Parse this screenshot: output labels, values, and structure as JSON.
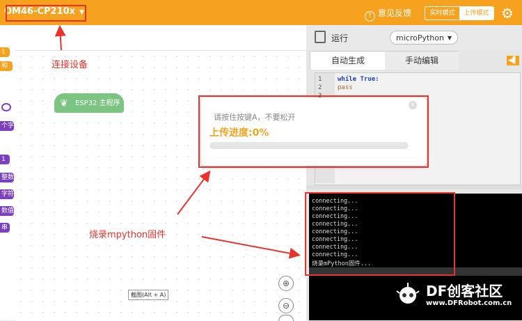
{
  "topbar": {
    "device_label": "OM46-CP210x",
    "feedback_label": "意见反馈",
    "mode_realtime": "实时模式",
    "mode_upload": "上传模式",
    "accent_color": "#f7a21e"
  },
  "toolbar": {
    "run_label": "运行",
    "language_selected": "microPython"
  },
  "tabs": [
    "自动生成",
    "手动编辑"
  ],
  "code_lines": [
    {
      "num": "1",
      "text": "while True:"
    },
    {
      "num": "2",
      "text": "  pass"
    },
    {
      "num": "3",
      "text": ""
    }
  ],
  "block": {
    "label": "ESP32 主程序"
  },
  "sidebar_chips": [
    "1",
    "和",
    "个字",
    "1",
    "整数",
    "字符",
    "数值",
    "串"
  ],
  "annotations": {
    "connect_device": "连接设备",
    "burn_firmware": "烧录mpython固件"
  },
  "dialog": {
    "hint": "请按住按键A，不要松开",
    "progress_label": "上传进度:0%",
    "progress_fraction": 0
  },
  "terminal_lines": [
    "connecting...",
    "connecting...",
    "connecting...",
    "connecting...",
    "connecting...",
    "connecting...",
    "connecting...",
    "connecting...",
    "烧录mPython固件..."
  ],
  "tooltip": "截图(Alt + A)",
  "watermark": {
    "brand": "DF创客社区",
    "url": "www.DFRobot.com.cn"
  }
}
